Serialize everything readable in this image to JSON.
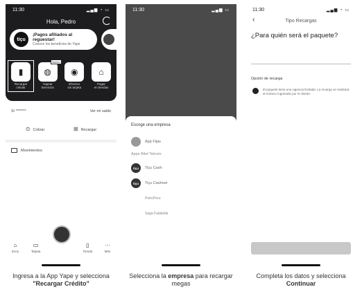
{
  "phone1": {
    "status_time": "11:30",
    "header_title": "Hola, Pedro",
    "promo": {
      "logo": "tiçu",
      "title": "¡Pagos afiliados al reguestar!",
      "subtitle": "Conoce los beneficios de Yape"
    },
    "services": [
      {
        "label": "Recargar\ncelular",
        "icon": "phone-card-icon"
      },
      {
        "label": "Yapear\nServicios",
        "icon": "services-icon",
        "badge": "Nuevo"
      },
      {
        "label": "Efectivo\nsin tarjeta",
        "icon": "cash-icon"
      },
      {
        "label": "Pagar\nen tiendas",
        "icon": "store-icon"
      }
    ],
    "account_mask": "S/ *******",
    "account_link": "Ver mi saldo",
    "actions": [
      "Cobrar",
      "Recargar"
    ],
    "movements": "Movimientos",
    "tabs": [
      "Inicio",
      "Tarjeta",
      "Tienda",
      "Más"
    ]
  },
  "phone2": {
    "status_time": "11:30",
    "heading": "Escoge una empresa",
    "first": "App Fijas",
    "subheading": "Apps Bitel Telcom",
    "options": [
      {
        "logo": "tiçu",
        "name": "Tiçu Cash"
      },
      {
        "logo": "tiçu",
        "name": "Tiçu Cashnet"
      }
    ],
    "text_options": [
      "PetroPeru",
      "Saga Falabella"
    ]
  },
  "phone3": {
    "status_time": "11:30",
    "nav_title": "Tipo Recargas",
    "question": "¿Para quién será el paquete?",
    "optional": "Opción de recarga",
    "info": "El paquete tiene una vigencia limitada. La recarga se realizará al número ingresado por el cliente."
  },
  "captions": {
    "c1_pre": "Ingresa a la App Yape y selecciona",
    "c1_bold": "\"Recargar Crédito\"",
    "c2_pre": "Selecciona la ",
    "c2_bold": "empresa",
    "c2_post": " para recargar megas",
    "c3_pre": "Completa los datos y selecciona ",
    "c3_bold": "Continuar"
  }
}
